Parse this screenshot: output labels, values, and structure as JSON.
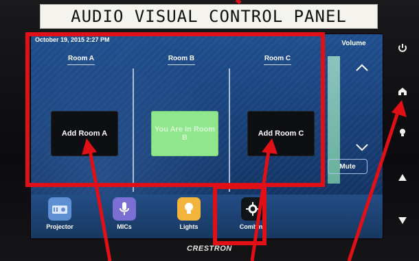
{
  "label_strip": {
    "text": "AUDIO VISUAL CONTROL PANEL"
  },
  "screen": {
    "datetime": "October 19, 2015 2:27 PM",
    "rooms": [
      {
        "title": "Room A",
        "button_label": "Add Room A",
        "state": "add"
      },
      {
        "title": "Room B",
        "button_label": "You Are In Room B",
        "state": "current"
      },
      {
        "title": "Room C",
        "button_label": "Add Room C",
        "state": "add"
      }
    ],
    "volume": {
      "title": "Volume",
      "up_icon": "chevron-up-icon",
      "down_icon": "chevron-down-icon",
      "mute_label": "Mute"
    },
    "dock": [
      {
        "label": "Projector",
        "icon": "projector-icon",
        "color": "#5d8fd2"
      },
      {
        "label": "MICs",
        "icon": "microphone-icon",
        "color": "#7b6fd3"
      },
      {
        "label": "Lights",
        "icon": "lightbulb-icon",
        "color": "#f2b43b"
      },
      {
        "label": "Combine",
        "icon": "gear-icon",
        "color": "#101317"
      }
    ]
  },
  "device": {
    "brand": "CRESTRON"
  },
  "side_buttons": [
    "power-icon",
    "home-icon",
    "light-icon",
    "up-arrow-icon",
    "down-arrow-icon"
  ],
  "annotation": {
    "color": "#e10f16"
  }
}
